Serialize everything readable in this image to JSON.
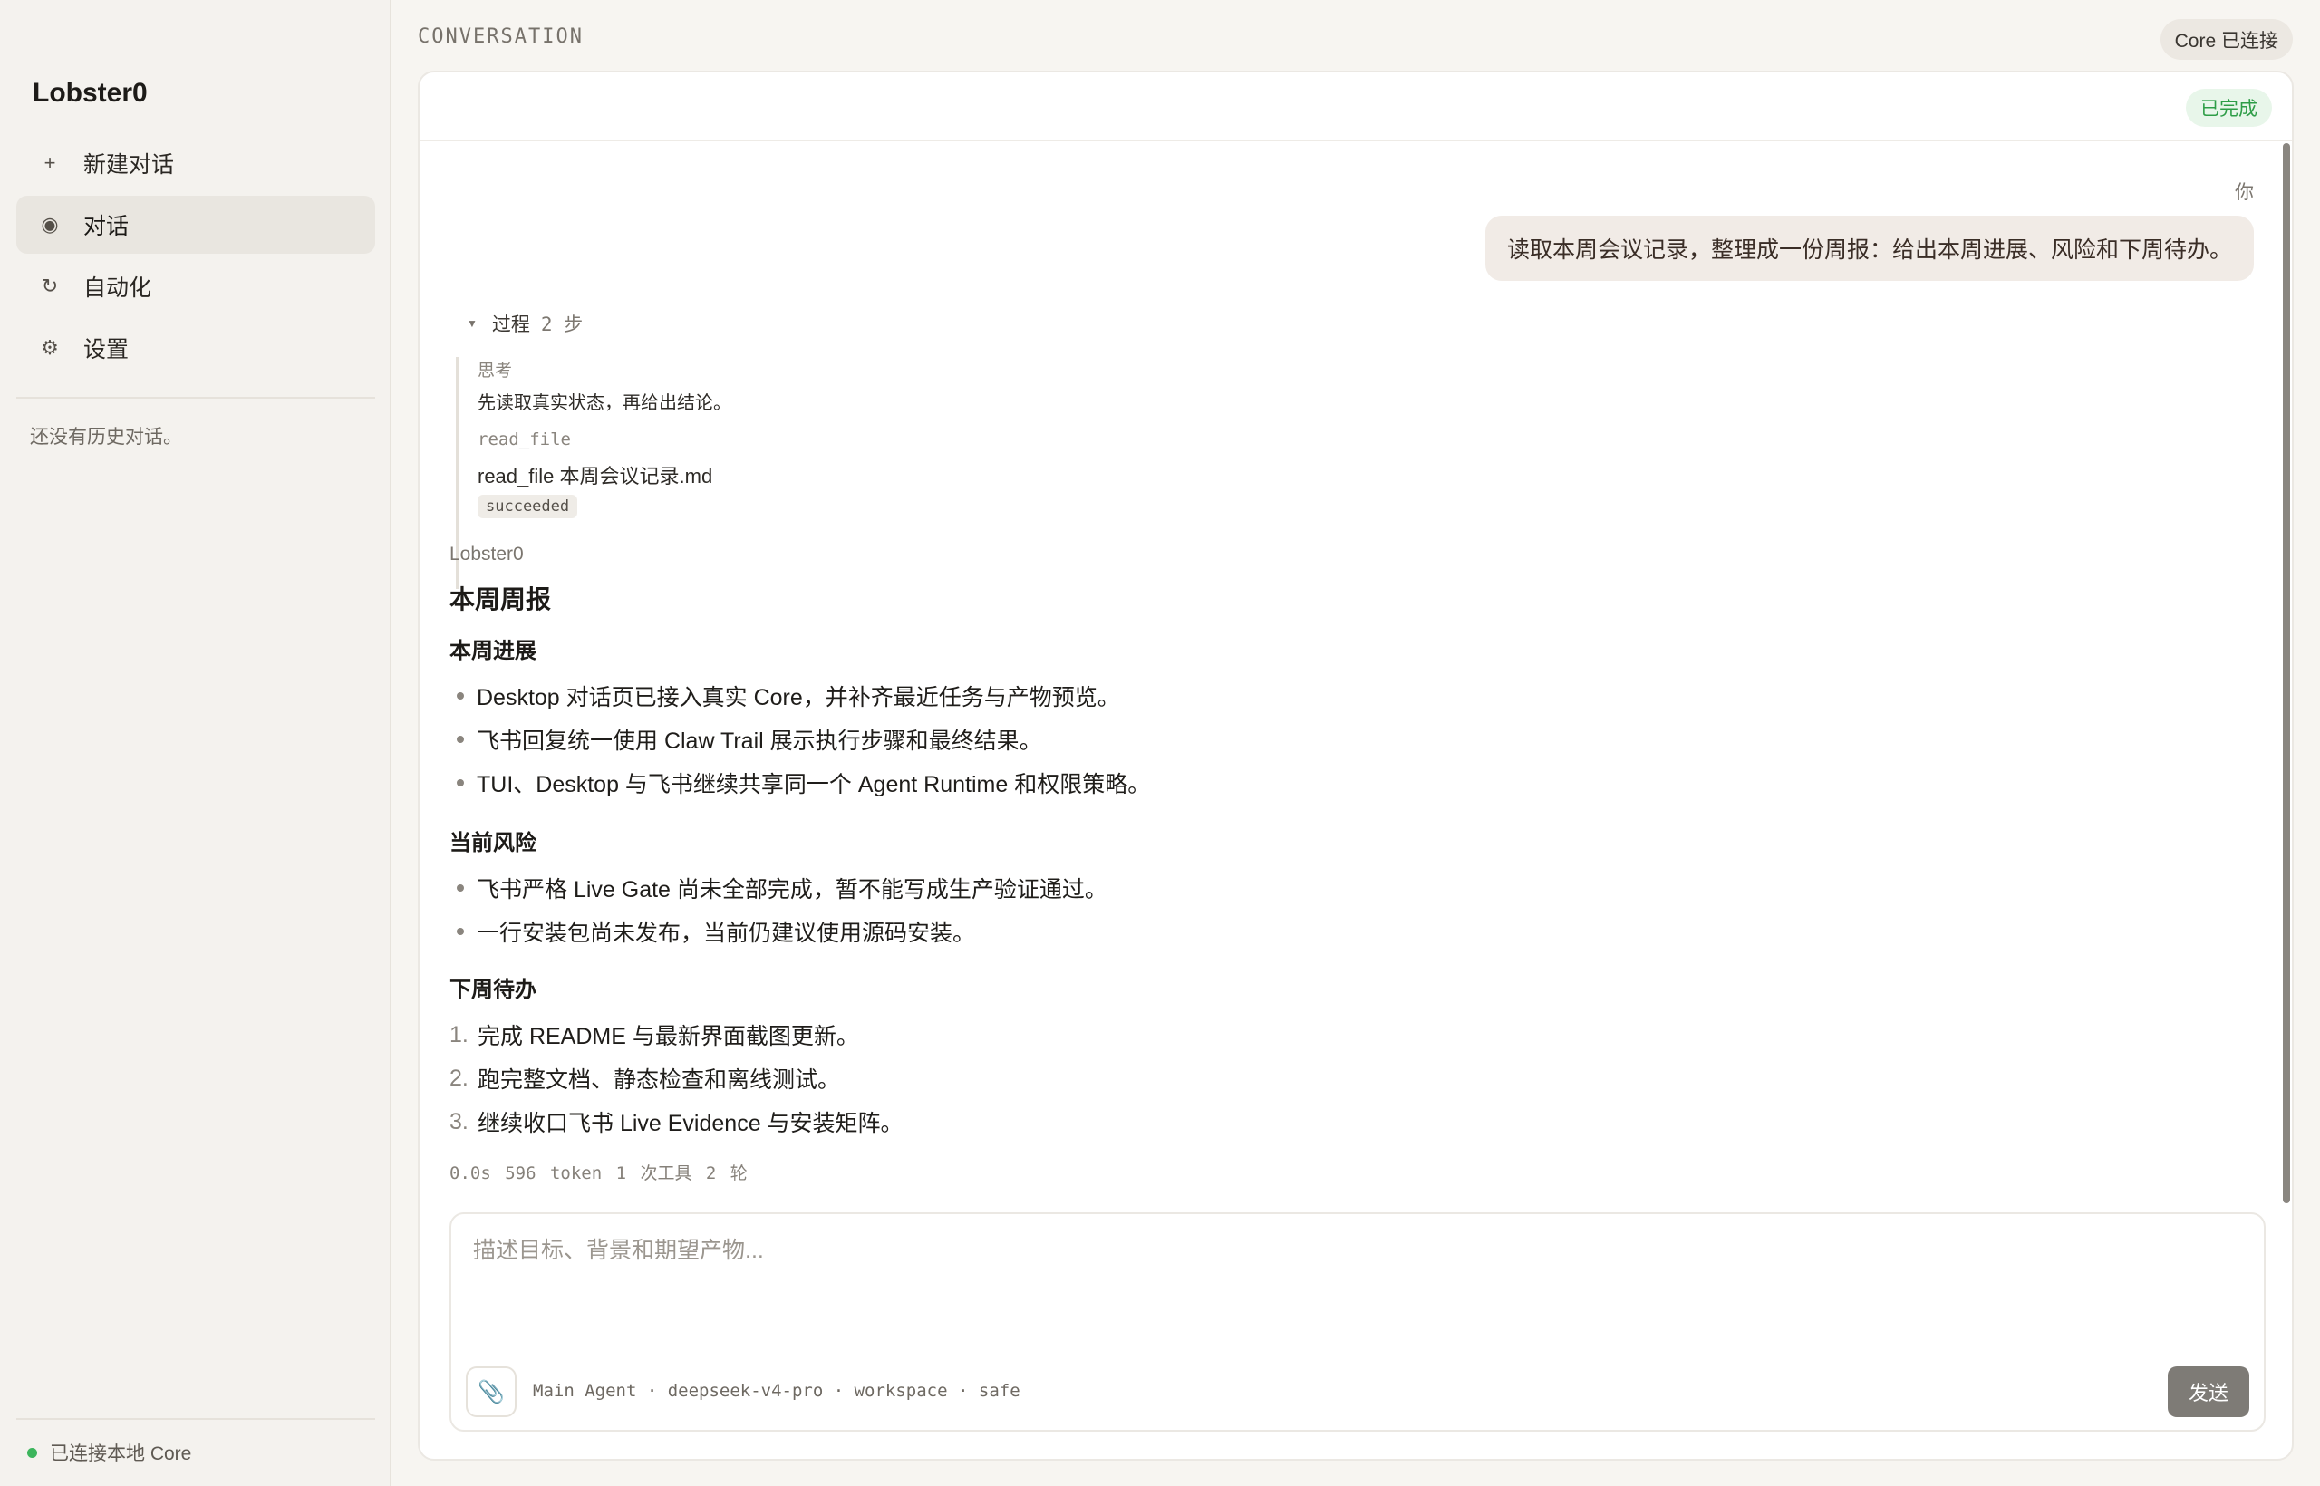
{
  "sidebar": {
    "brand": "Lobster0",
    "items": [
      {
        "icon": "plus-icon",
        "glyph": "+",
        "label": "新建对话"
      },
      {
        "icon": "dot-icon",
        "glyph": "◉",
        "label": "对话"
      },
      {
        "icon": "refresh-icon",
        "glyph": "↻",
        "label": "自动化"
      },
      {
        "icon": "gear-icon",
        "glyph": "⚙",
        "label": "设置"
      }
    ],
    "active_item": "对话",
    "no_history": "还没有历史对话。",
    "status": "已连接本地 Core"
  },
  "header": {
    "section_label": "CONVERSATION",
    "core_status": "Core 已连接"
  },
  "card": {
    "done_badge": "已完成",
    "user": {
      "label": "你",
      "message": "读取本周会议记录，整理成一份周报：给出本周进展、风险和下周待办。"
    },
    "process": {
      "label": "过程",
      "steps": "2 步",
      "thinking_label": "思考",
      "thinking_text": "先读取真实状态，再给出结论。",
      "tool_name": "read_file",
      "tool_call": "read_file 本周会议记录.md",
      "tool_status": "succeeded"
    },
    "agent_name": "Lobster0",
    "answer": {
      "title": "本周周报",
      "section1": "本周进展",
      "progress": [
        "Desktop 对话页已接入真实 Core，并补齐最近任务与产物预览。",
        "飞书回复统一使用 Claw Trail 展示执行步骤和最终结果。",
        "TUI、Desktop 与飞书继续共享同一个 Agent Runtime 和权限策略。"
      ],
      "section2": "当前风险",
      "risks": [
        "飞书严格 Live Gate 尚未全部完成，暂不能写成生产验证通过。",
        "一行安装包尚未发布，当前仍建议使用源码安装。"
      ],
      "section3": "下周待办",
      "todos": [
        {
          "num": "1.",
          "text": "完成 README 与最新界面截图更新。"
        },
        {
          "num": "2.",
          "text": "跑完整文档、静态检查和离线测试。"
        },
        {
          "num": "3.",
          "text": "继续收口飞书 Live Evidence 与安装矩阵。"
        }
      ]
    },
    "metrics": "0.0s  596 token  1 次工具  2 轮"
  },
  "composer": {
    "placeholder": "描述目标、背景和期望产物...",
    "meta": "Main Agent · deepseek-v4-pro · workspace · safe",
    "send_label": "发送"
  }
}
